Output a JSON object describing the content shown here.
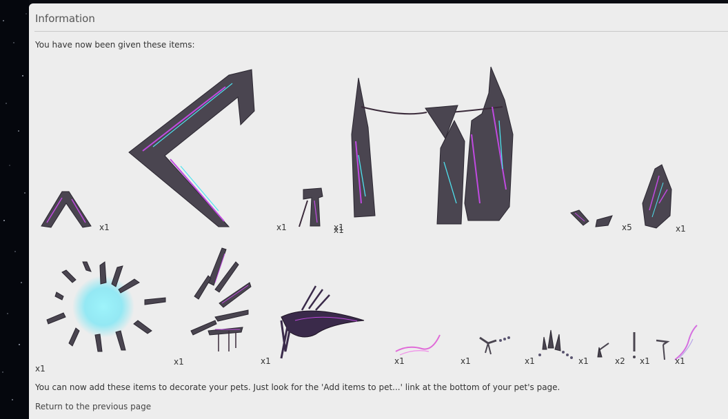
{
  "panel": {
    "title": "Information",
    "intro": "You have now been given these items:",
    "footer": "You can now add these items to decorate your pets. Just look for the 'Add items to pet...' link at the bottom of your pet's page.",
    "return_link": "Return to the previous page"
  },
  "items": [
    {
      "icon": "small-rune-stone-arch-icon",
      "quantity": "x1"
    },
    {
      "icon": "large-rune-stone-arch-icon",
      "quantity": "x1"
    },
    {
      "icon": "rune-stone-post-icon",
      "quantity": "x1"
    },
    {
      "icon": "rune-monolith-garland-icon",
      "quantity": "x1"
    },
    {
      "icon": "rune-stone-shard-icon",
      "quantity": "x5"
    },
    {
      "icon": "rune-boulder-icon",
      "quantity": "x1"
    },
    {
      "icon": "glowing-crystal-ring-icon",
      "quantity": "x1"
    },
    {
      "icon": "crystal-wings-icon",
      "quantity": "x1"
    },
    {
      "icon": "dark-feather-wing-icon",
      "quantity": "x1"
    },
    {
      "icon": "pink-wisp-icon",
      "quantity": "x1"
    },
    {
      "icon": "beaded-chain-icon",
      "quantity": "x1"
    },
    {
      "icon": "crystal-necklace-icon",
      "quantity": "x1"
    },
    {
      "icon": "small-charm-icon",
      "quantity": "x1"
    },
    {
      "icon": "earring-icon",
      "quantity": "x2"
    },
    {
      "icon": "small-pendant-icon",
      "quantity": "x1"
    },
    {
      "icon": "pink-wisp-tail-icon",
      "quantity": "x1"
    }
  ],
  "colors": {
    "stone": "#4a4550",
    "rune_purple": "#c04ae0",
    "rune_cyan": "#4fe3f0",
    "panel": "#ededed"
  }
}
